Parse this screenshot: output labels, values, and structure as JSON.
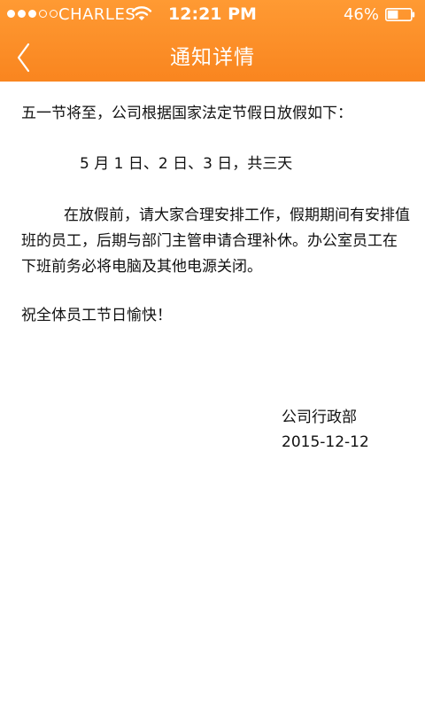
{
  "status_bar": {
    "carrier": "CHARLES",
    "time": "12:21 PM",
    "battery_percent": "46%",
    "battery_level": 0.46,
    "signal_bars": 3,
    "signal_total": 5,
    "icons": [
      "signal-dots-icon",
      "wifi-icon",
      "battery-icon"
    ]
  },
  "nav": {
    "title": "通知详情",
    "back_icon": "chevron-left-icon"
  },
  "notice": {
    "intro": "五一节将至，公司根据国家法定节假日放假如下：",
    "dates": "5 月 1 日、2 日、3 日，共三天",
    "body": "在放假前，请大家合理安排工作，假期期间有安排值班的员工，后期与部门主管申请合理补休。办公室员工在下班前务必将电脑及其他电源关闭。",
    "closing": "祝全体员工节日愉快！",
    "signature": "公司行政部",
    "date": "2015-12-12"
  },
  "colors": {
    "header_top": "#ff9a33",
    "header_bottom": "#f9851f",
    "header_text": "#ffffff",
    "body_text": "#111111",
    "background": "#ffffff"
  }
}
